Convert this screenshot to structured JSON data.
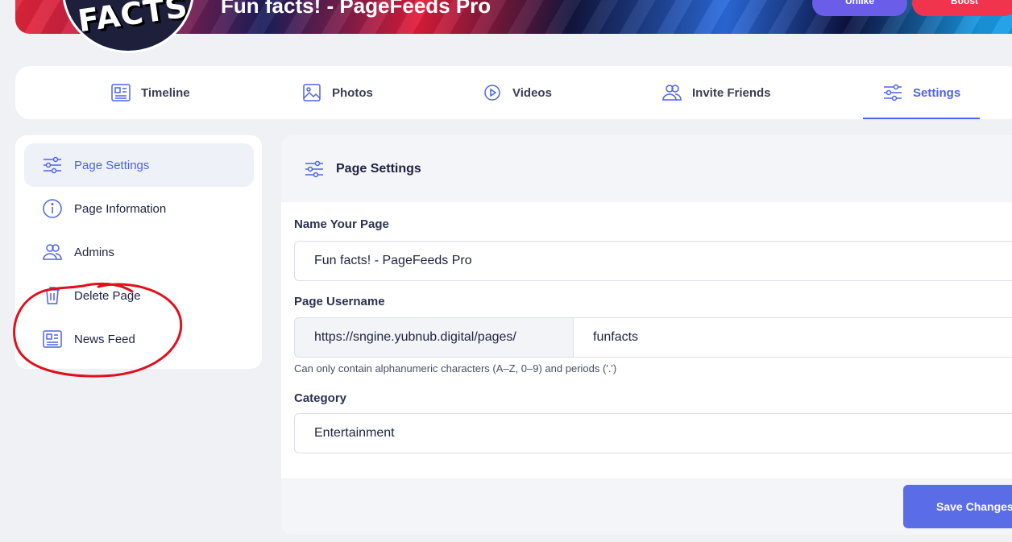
{
  "cover": {
    "page_title": "Fun facts! - PageFeeds Pro",
    "avatar_text": "FACTS",
    "unlike_label": "Unlike",
    "boost_label": "Boost"
  },
  "tabs": [
    {
      "label": "Timeline",
      "icon": "newspaper-icon"
    },
    {
      "label": "Photos",
      "icon": "image-icon"
    },
    {
      "label": "Videos",
      "icon": "play-circle-icon"
    },
    {
      "label": "Invite Friends",
      "icon": "users-icon"
    },
    {
      "label": "Settings",
      "icon": "sliders-icon",
      "active": true
    }
  ],
  "sidebar": {
    "items": [
      {
        "label": "Page Settings",
        "icon": "sliders-icon",
        "active": true
      },
      {
        "label": "Page Information",
        "icon": "info-icon"
      },
      {
        "label": "Admins",
        "icon": "users-icon"
      },
      {
        "label": "Delete Page",
        "icon": "trash-icon"
      },
      {
        "label": "News Feed",
        "icon": "newspaper-icon"
      }
    ]
  },
  "panel": {
    "title": "Page Settings",
    "name_label": "Name Your Page",
    "name_value": "Fun facts! - PageFeeds Pro",
    "username_label": "Page Username",
    "username_prefix": "https://sngine.yubnub.digital/pages/",
    "username_value": "funfacts",
    "username_hint": "Can only contain alphanumeric characters (A–Z, 0–9) and periods ('.')",
    "category_label": "Category",
    "category_value": "Entertainment",
    "save_label": "Save Changes"
  },
  "colors": {
    "accent": "#4e63e6",
    "save_button": "#5b6de6",
    "annotation": "#e0101c"
  }
}
